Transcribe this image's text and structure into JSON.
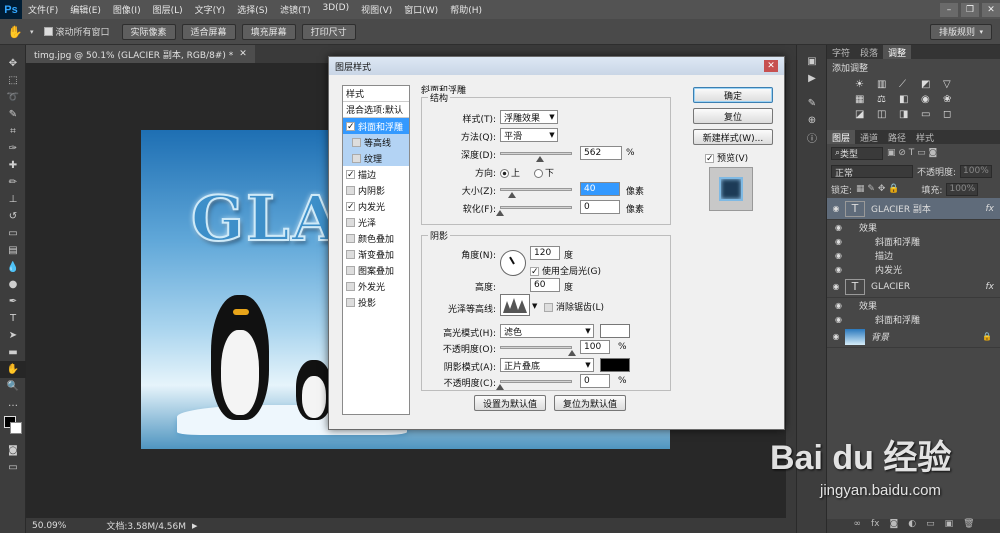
{
  "menubar": {
    "logo": "Ps",
    "items": [
      "文件(F)",
      "编辑(E)",
      "图像(I)",
      "图层(L)",
      "文字(Y)",
      "选择(S)",
      "滤镜(T)",
      "3D(D)",
      "视图(V)",
      "窗口(W)",
      "帮助(H)"
    ]
  },
  "options": {
    "scroll_all_label": "滚动所有窗口",
    "buttons": [
      "实际像素",
      "适合屏幕",
      "填充屏幕",
      "打印尺寸"
    ],
    "workspace": "排版规则"
  },
  "document": {
    "tab_title": "timg.jpg @ 50.1% (GLACIER 副本, RGB/8#) *",
    "canvas_text": "GLA",
    "zoom": "50.09%",
    "doc_size": "文档:3.58M/4.56M"
  },
  "dialog": {
    "title": "图层样式",
    "styles_header": "样式",
    "blend_options": "混合选项:默认",
    "style_items": [
      {
        "label": "斜面和浮雕",
        "checked": true,
        "selected": true,
        "sub": false
      },
      {
        "label": "等高线",
        "checked": false,
        "selected": false,
        "sub": true
      },
      {
        "label": "纹理",
        "checked": false,
        "selected": false,
        "sub": true
      },
      {
        "label": "描边",
        "checked": true,
        "selected": false,
        "sub": false
      },
      {
        "label": "内阴影",
        "checked": false,
        "selected": false,
        "sub": false
      },
      {
        "label": "内发光",
        "checked": true,
        "selected": false,
        "sub": false
      },
      {
        "label": "光泽",
        "checked": false,
        "selected": false,
        "sub": false
      },
      {
        "label": "颜色叠加",
        "checked": false,
        "selected": false,
        "sub": false
      },
      {
        "label": "渐变叠加",
        "checked": false,
        "selected": false,
        "sub": false
      },
      {
        "label": "图案叠加",
        "checked": false,
        "selected": false,
        "sub": false
      },
      {
        "label": "外发光",
        "checked": false,
        "selected": false,
        "sub": false
      },
      {
        "label": "投影",
        "checked": false,
        "selected": false,
        "sub": false
      }
    ],
    "section_title": "斜面和浮雕",
    "structure": {
      "title": "结构",
      "style_label": "样式(T):",
      "style_value": "浮雕效果",
      "technique_label": "方法(Q):",
      "technique_value": "平滑",
      "depth_label": "深度(D):",
      "depth_value": "562",
      "depth_unit": "%",
      "depth_fraction": 0.56,
      "direction_label": "方向:",
      "dir_up": "上",
      "dir_down": "下",
      "size_label": "大小(Z):",
      "size_value": "40",
      "size_unit": "像素",
      "size_fraction": 0.16,
      "soften_label": "软化(F):",
      "soften_value": "0",
      "soften_unit": "像素",
      "soften_fraction": 0
    },
    "shading": {
      "title": "阴影",
      "angle_label": "角度(N):",
      "angle_value": "120",
      "angle_unit": "度",
      "global_light": "使用全局光(G)",
      "altitude_label": "高度:",
      "altitude_value": "60",
      "altitude_unit": "度",
      "gloss_label": "光泽等高线:",
      "antialias": "消除锯齿(L)",
      "highlight_label": "高光模式(H):",
      "highlight_value": "滤色",
      "highlight_color": "#ffffff",
      "hl_opacity_label": "不透明度(O):",
      "hl_opacity_value": "100",
      "hl_opacity_unit": "%",
      "hl_opacity_fraction": 1.0,
      "shadow_label": "阴影模式(A):",
      "shadow_value": "正片叠底",
      "shadow_color": "#000000",
      "sh_opacity_label": "不透明度(C):",
      "sh_opacity_value": "0",
      "sh_opacity_unit": "%",
      "sh_opacity_fraction": 0
    },
    "make_default": "设置为默认值",
    "reset_default": "复位为默认值",
    "ok": "确定",
    "reset": "复位",
    "new_style": "新建样式(W)...",
    "preview": "预览(V)"
  },
  "panels": {
    "top_tabs": [
      "字符",
      "段落",
      "调整"
    ],
    "add_adjustment": "添加调整",
    "layer_tabs": [
      "图层",
      "通道",
      "路径",
      "样式"
    ],
    "kind": "类型",
    "blend_mode": "正常",
    "opacity_label": "不透明度:",
    "opacity_value": "100%",
    "lock_label": "锁定:",
    "fill_label": "填充:",
    "fill_value": "100%",
    "layers": [
      {
        "name": "GLACIER 副本",
        "type": "T",
        "effects": [
          "效果",
          "斜面和浮雕",
          "描边",
          "内发光"
        ]
      },
      {
        "name": "GLACIER",
        "type": "T",
        "effects": [
          "效果",
          "斜面和浮雕"
        ]
      },
      {
        "name": "背景",
        "type": "img",
        "effects": []
      }
    ],
    "fx": "fx"
  },
  "watermark": {
    "brand": "Bai du 经验",
    "url": "jingyan.baidu.com"
  }
}
